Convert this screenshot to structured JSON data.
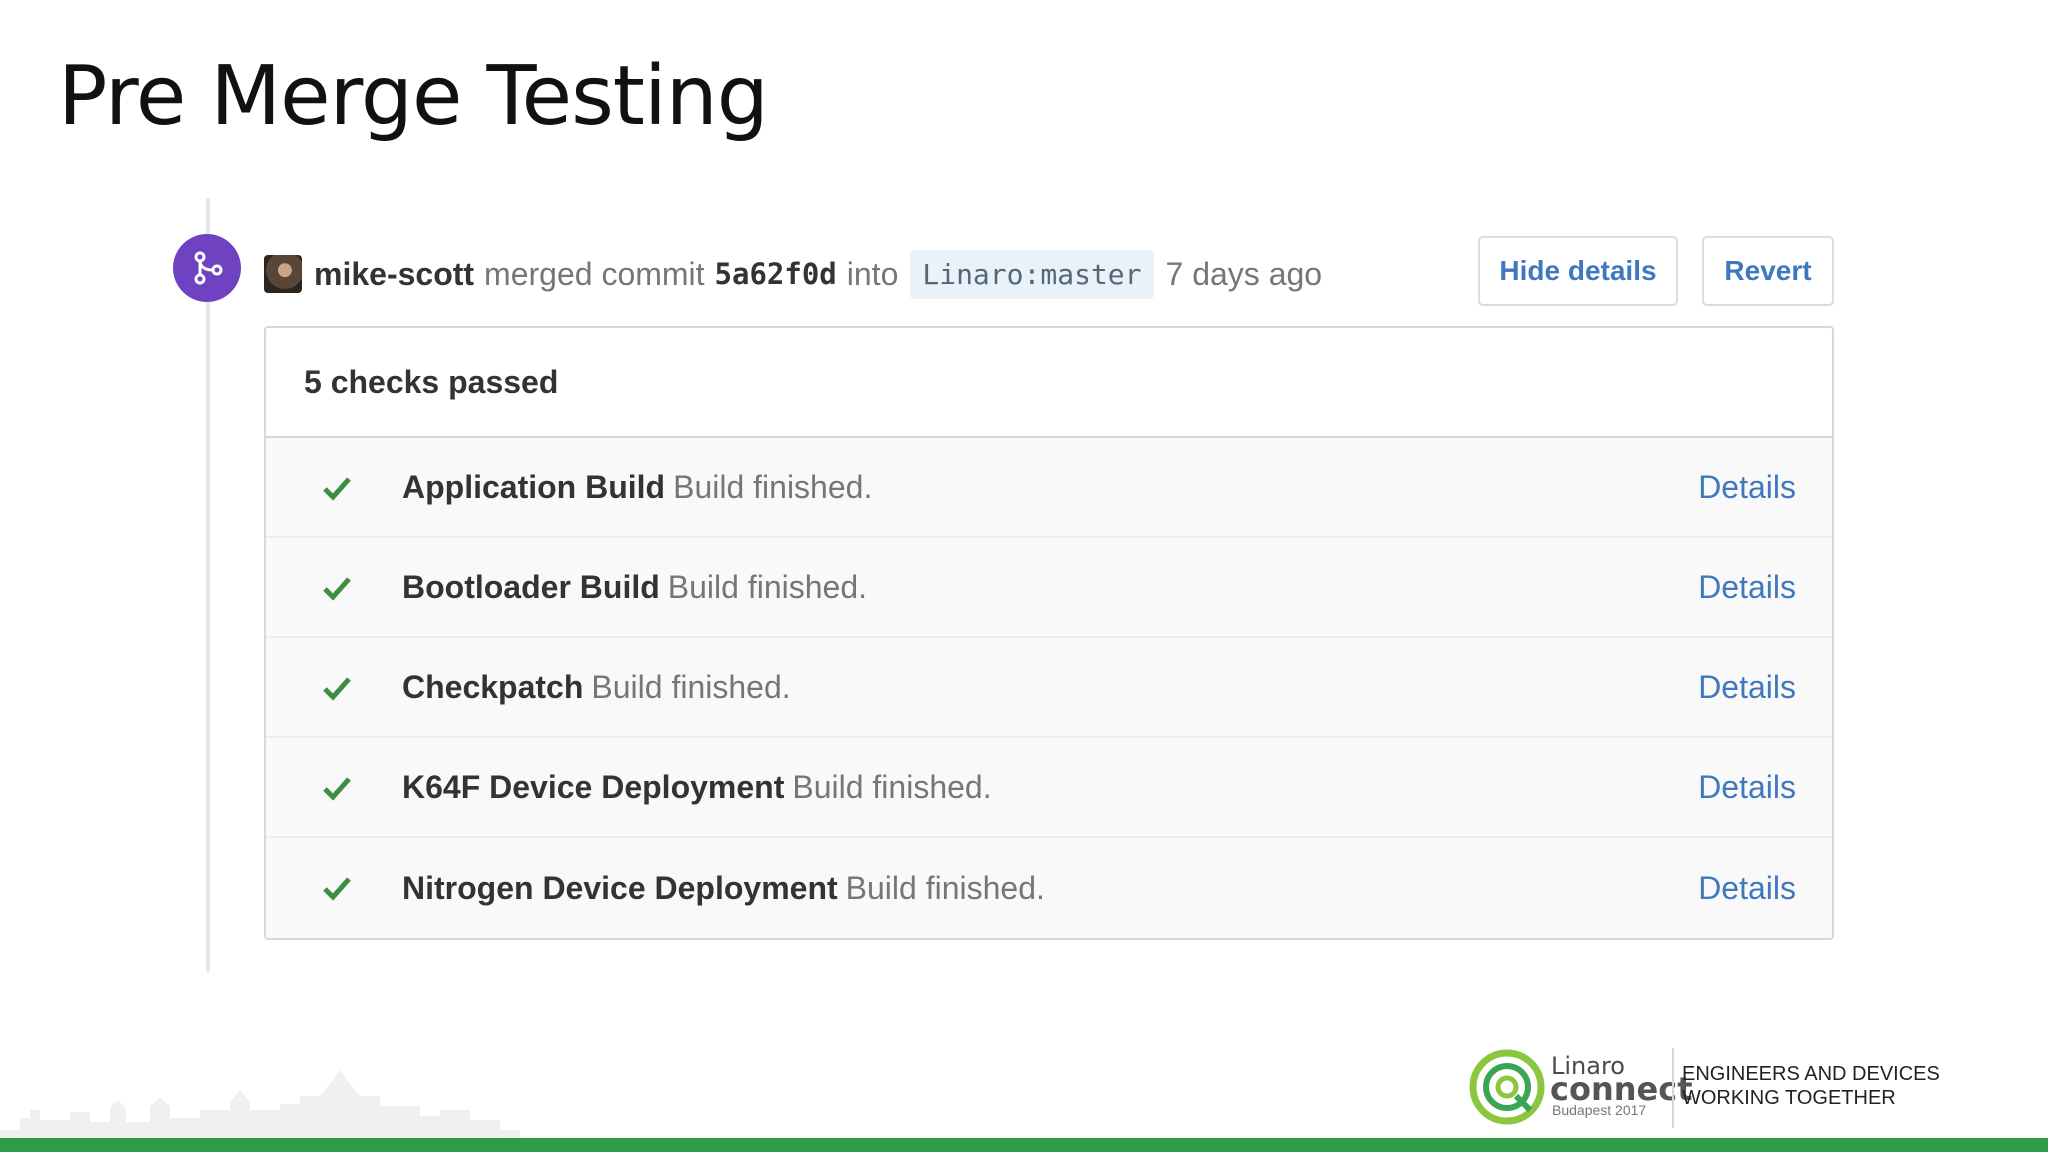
{
  "slide": {
    "title": "Pre Merge Testing"
  },
  "event": {
    "author": "mike-scott",
    "action": "merged commit",
    "commit_sha": "5a62f0d",
    "into_word": "into",
    "branch": "Linaro:master",
    "time_ago": "7 days ago",
    "badge_icon": "git-merge-icon",
    "badge_color": "#6f42c1"
  },
  "actions": {
    "hide_details": "Hide details",
    "revert": "Revert"
  },
  "checks": {
    "summary": "5 checks passed",
    "items": [
      {
        "name": "Application Build",
        "status": "Build finished.",
        "link": "Details",
        "icon": "check-icon"
      },
      {
        "name": "Bootloader Build",
        "status": "Build finished.",
        "link": "Details",
        "icon": "check-icon"
      },
      {
        "name": "Checkpatch",
        "status": "Build finished.",
        "link": "Details",
        "icon": "check-icon"
      },
      {
        "name": "K64F Device Deployment",
        "status": "Build finished.",
        "link": "Details",
        "icon": "check-icon"
      },
      {
        "name": "Nitrogen Device Deployment",
        "status": "Build finished.",
        "link": "Details",
        "icon": "check-icon"
      }
    ],
    "success_color": "#3e8e41",
    "link_color": "#4078c0"
  },
  "footer": {
    "brand_line1": "Linaro",
    "brand_line2": "connect",
    "brand_line3": "Budapest 2017",
    "tagline_line1": "ENGINEERS AND DEVICES",
    "tagline_line2": "WORKING TOGETHER",
    "accent_color": "#2e9b48"
  }
}
